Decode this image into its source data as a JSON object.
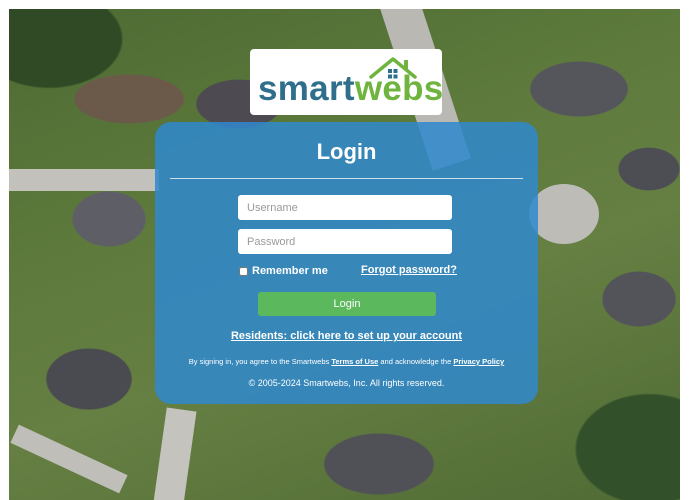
{
  "brand": {
    "name_part1": "smart",
    "name_part2": "webs",
    "colors": {
      "primary": "#2f6f8c",
      "accent": "#6fb43f"
    },
    "logo_icon": "house-icon"
  },
  "login": {
    "title": "Login",
    "username_placeholder": "Username",
    "password_placeholder": "Password",
    "username_value": "",
    "password_value": "",
    "remember_label": "Remember me",
    "remember_checked": false,
    "forgot_label": "Forgot password?",
    "submit_label": "Login",
    "residents_link": "Residents: click here to set up your account",
    "terms_prefix": "By signing in, you agree to the Smartwebs ",
    "terms_link": "Terms of Use",
    "terms_middle": " and acknowledge the ",
    "privacy_link": "Privacy Policy",
    "copyright": "© 2005-2024 Smartwebs, Inc. All rights reserved.",
    "panel_color": "#3088cd",
    "button_color": "#5cb85c"
  }
}
